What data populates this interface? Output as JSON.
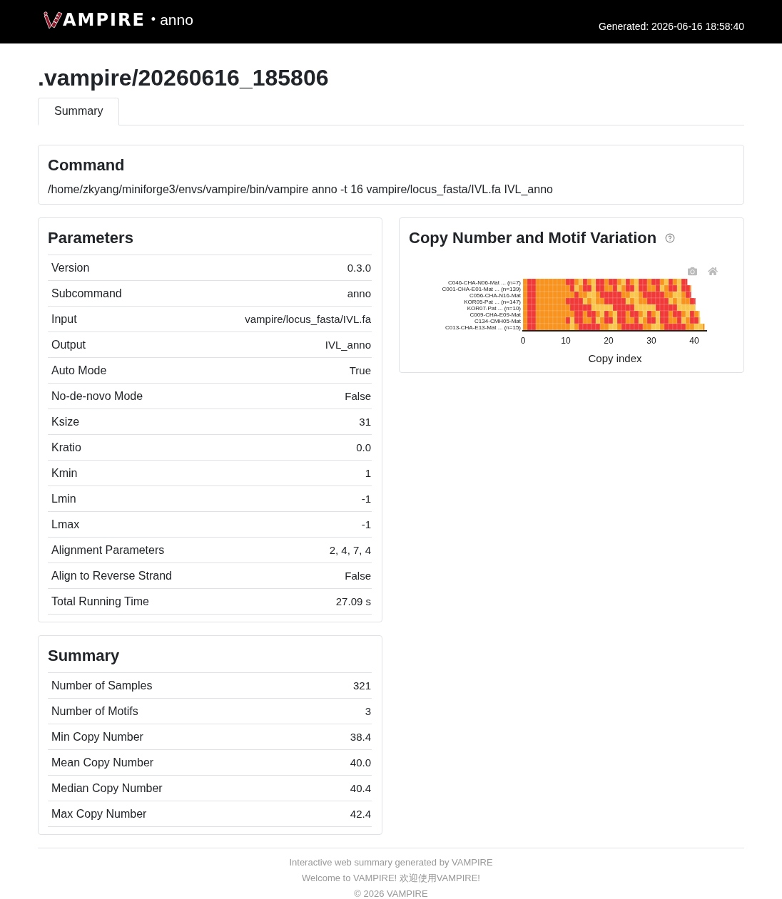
{
  "header": {
    "logo_text": "AMPIRE",
    "separator": "•",
    "module": "anno",
    "generated": "Generated: 2026-06-16 18:58:40"
  },
  "page_title": ".vampire/20260616_185806",
  "tabs": [
    {
      "label": "Summary",
      "selected": true
    }
  ],
  "command": {
    "title": "Command",
    "text": "/home/zkyang/miniforge3/envs/vampire/bin/vampire anno -t 16 vampire/locus_fasta/IVL.fa IVL_anno"
  },
  "parameters": {
    "title": "Parameters",
    "rows": [
      {
        "label": "Version",
        "value": "0.3.0"
      },
      {
        "label": "Subcommand",
        "value": "anno"
      },
      {
        "label": "Input",
        "value": "vampire/locus_fasta/IVL.fa"
      },
      {
        "label": "Output",
        "value": "IVL_anno"
      },
      {
        "label": "Auto Mode",
        "value": "True"
      },
      {
        "label": "No-de-novo Mode",
        "value": "False"
      },
      {
        "label": "Ksize",
        "value": "31"
      },
      {
        "label": "Kratio",
        "value": "0.0"
      },
      {
        "label": "Kmin",
        "value": "1"
      },
      {
        "label": "Lmin",
        "value": "-1"
      },
      {
        "label": "Lmax",
        "value": "-1"
      },
      {
        "label": "Alignment Parameters",
        "value": "2, 4, 7, 4"
      },
      {
        "label": "Align to Reverse Strand",
        "value": "False"
      },
      {
        "label": "Total Running Time",
        "value": "27.09 s"
      }
    ]
  },
  "summary": {
    "title": "Summary",
    "rows": [
      {
        "label": "Number of Samples",
        "value": "321"
      },
      {
        "label": "Number of Motifs",
        "value": "3"
      },
      {
        "label": "Min Copy Number",
        "value": "38.4"
      },
      {
        "label": "Mean Copy Number",
        "value": "40.0"
      },
      {
        "label": "Median Copy Number",
        "value": "40.4"
      },
      {
        "label": "Max Copy Number",
        "value": "42.4"
      }
    ]
  },
  "copy_number_panel": {
    "title": "Copy Number and Motif Variation",
    "heatmap": {
      "row_labels": [
        "C046-CHA-N06-Mat ... (n=7)",
        "C001-CHA-E01-Mat ... (n=139)",
        "C056-CHA-N16-Mat",
        "KOR05-Pat ... (n=147)",
        "KOR07-Pat ... (n=10)",
        "C009-CHA-E09-Mat",
        "C134-CMH05-Mat",
        "C013-CHA-E13-Mat ... (n=15)"
      ],
      "xticks": [
        "0",
        "10",
        "20",
        "30",
        "40"
      ],
      "xlabel": "Copy index"
    }
  },
  "footer": [
    "Interactive web summary generated by VAMPIRE",
    "Welcome to VAMPIRE! 欢迎使用VAMPIRE!",
    "© 2026 VAMPIRE"
  ]
}
